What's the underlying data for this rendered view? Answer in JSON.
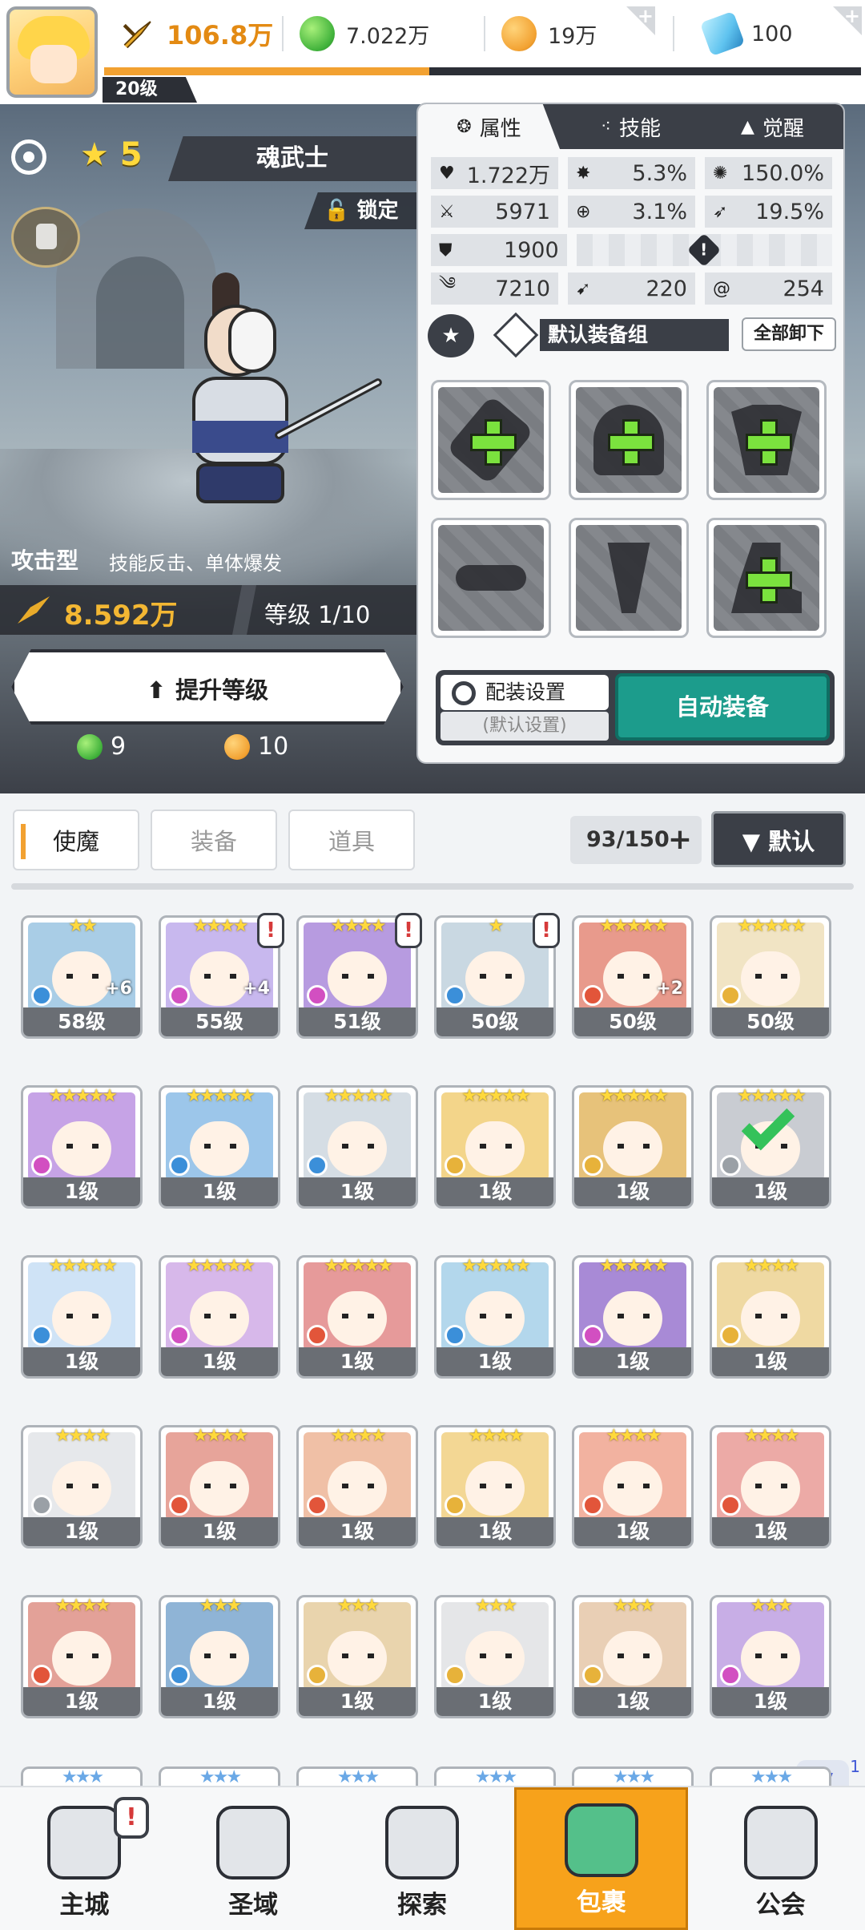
{
  "header": {
    "player_level": "20级",
    "power": "106.8万",
    "green_currency": "7.022万",
    "gold_currency": "19万",
    "gem_currency": "100",
    "colors": {
      "accent": "#f2a131",
      "dark": "#2c2f36"
    }
  },
  "hero": {
    "stars": "5",
    "name": "魂武士",
    "lock_label": "锁定",
    "type": "攻击型",
    "description": "技能反击、单体爆发",
    "power": "8.592万",
    "level_text": "等级 1/10",
    "upgrade_label": "提升等级",
    "cost_green": "9",
    "cost_gold": "10"
  },
  "panel": {
    "tabs": [
      {
        "label": "属性",
        "icon": "attribute-icon"
      },
      {
        "label": "技能",
        "icon": "skill-icon"
      },
      {
        "label": "觉醒",
        "icon": "awaken-icon"
      }
    ],
    "stats": {
      "hp": "1.722万",
      "crit_rate": "5.3%",
      "crit_damage": "150.0%",
      "attack": "5971",
      "accuracy": "3.1%",
      "dodge": "19.5%",
      "defense": "1900",
      "speed": "7210",
      "stat_a": "220",
      "stat_b": "254"
    },
    "equip_group": "默认装备组",
    "unequip_all": "全部卸下",
    "loadout_settings": "配装设置",
    "loadout_default": "(默认设置)",
    "auto_equip": "自动装备"
  },
  "bag": {
    "tabs": [
      "使魔",
      "装备",
      "道具"
    ],
    "count": "93/150",
    "sort_label": "默认",
    "items": [
      {
        "stars": "★★",
        "level": "58级",
        "color": "#a9cde6",
        "elem": "#3b8fd9",
        "plus": "+6",
        "alert": false
      },
      {
        "stars": "★★★★",
        "level": "55级",
        "color": "#c8b8ee",
        "elem": "#d24fc1",
        "plus": "+4",
        "alert": true
      },
      {
        "stars": "★★★★",
        "level": "51级",
        "color": "#b79be0",
        "elem": "#d24fc1",
        "plus": "",
        "alert": true
      },
      {
        "stars": "★",
        "level": "50级",
        "color": "#c9d8e2",
        "elem": "#3b8fd9",
        "plus": "",
        "alert": true
      },
      {
        "stars": "★★★★★",
        "level": "50级",
        "color": "#e89a8c",
        "elem": "#e2553a",
        "plus": "+2",
        "alert": false
      },
      {
        "stars": "★★★★★",
        "level": "50级",
        "color": "#f1e4c4",
        "elem": "#e7b23a",
        "plus": "",
        "alert": false
      },
      {
        "stars": "★★★★★",
        "level": "1级",
        "color": "#c6a3e6",
        "elem": "#d24fc1",
        "plus": "",
        "alert": false
      },
      {
        "stars": "★★★★★",
        "level": "1级",
        "color": "#9cc6ea",
        "elem": "#3b8fd9",
        "plus": "",
        "alert": false
      },
      {
        "stars": "★★★★★",
        "level": "1级",
        "color": "#d5dde4",
        "elem": "#3b8fd9",
        "plus": "",
        "alert": false
      },
      {
        "stars": "★★★★★",
        "level": "1级",
        "color": "#f3d58a",
        "elem": "#e7b23a",
        "plus": "",
        "alert": false
      },
      {
        "stars": "★★★★★",
        "level": "1级",
        "color": "#e7c27a",
        "elem": "#e7b23a",
        "plus": "",
        "alert": false
      },
      {
        "stars": "★★★★★",
        "level": "1级",
        "color": "#c9ccd2",
        "elem": "#9aa0a6",
        "plus": "",
        "alert": false,
        "check": true
      },
      {
        "stars": "★★★★★",
        "level": "1级",
        "color": "#cfe3f6",
        "elem": "#3b8fd9",
        "plus": "",
        "alert": false
      },
      {
        "stars": "★★★★★",
        "level": "1级",
        "color": "#d7b8ea",
        "elem": "#d24fc1",
        "plus": "",
        "alert": false
      },
      {
        "stars": "★★★★★",
        "level": "1级",
        "color": "#e69a9a",
        "elem": "#e2553a",
        "plus": "",
        "alert": false
      },
      {
        "stars": "★★★★★",
        "level": "1级",
        "color": "#b3d7ec",
        "elem": "#3b8fd9",
        "plus": "",
        "alert": false
      },
      {
        "stars": "★★★★★",
        "level": "1级",
        "color": "#a88ad6",
        "elem": "#d24fc1",
        "plus": "",
        "alert": false
      },
      {
        "stars": "★★★★",
        "level": "1级",
        "color": "#efd9a2",
        "elem": "#e7b23a",
        "plus": "",
        "alert": false
      },
      {
        "stars": "★★★★",
        "level": "1级",
        "color": "#e6e8eb",
        "elem": "#9aa0a6",
        "plus": "",
        "alert": false
      },
      {
        "stars": "★★★★",
        "level": "1级",
        "color": "#e7a49a",
        "elem": "#e2553a",
        "plus": "",
        "alert": false
      },
      {
        "stars": "★★★★",
        "level": "1级",
        "color": "#f0c0a6",
        "elem": "#e2553a",
        "plus": "",
        "alert": false
      },
      {
        "stars": "★★★★",
        "level": "1级",
        "color": "#f3d794",
        "elem": "#e7b23a",
        "plus": "",
        "alert": false
      },
      {
        "stars": "★★★★",
        "level": "1级",
        "color": "#f2b2a0",
        "elem": "#e2553a",
        "plus": "",
        "alert": false
      },
      {
        "stars": "★★★★",
        "level": "1级",
        "color": "#ecaaa6",
        "elem": "#e2553a",
        "plus": "",
        "alert": false
      },
      {
        "stars": "★★★★",
        "level": "1级",
        "color": "#e3a198",
        "elem": "#e2553a",
        "plus": "",
        "alert": false
      },
      {
        "stars": "★★★",
        "level": "1级",
        "color": "#8fb4d6",
        "elem": "#3b8fd9",
        "plus": "",
        "alert": false
      },
      {
        "stars": "★★★",
        "level": "1级",
        "color": "#e9d4ad",
        "elem": "#e7b23a",
        "plus": "",
        "alert": false
      },
      {
        "stars": "★★★",
        "level": "1级",
        "color": "#e5e6e8",
        "elem": "#e7b23a",
        "plus": "",
        "alert": false
      },
      {
        "stars": "★★★",
        "level": "1级",
        "color": "#e9cfb5",
        "elem": "#e7b23a",
        "plus": "",
        "alert": false
      },
      {
        "stars": "★★★",
        "level": "1级",
        "color": "#c8aee6",
        "elem": "#d24fc1",
        "plus": "",
        "alert": false
      }
    ],
    "partial_row": [
      "★★★",
      "★★★",
      "★★★",
      "★★★",
      "★★★",
      "★★★"
    ]
  },
  "nav": [
    {
      "label": "主城",
      "alert": true,
      "active": false
    },
    {
      "label": "圣域",
      "alert": false,
      "active": false
    },
    {
      "label": "探索",
      "alert": false,
      "active": false
    },
    {
      "label": "包裹",
      "alert": false,
      "active": true
    },
    {
      "label": "公会",
      "alert": false,
      "active": false
    }
  ],
  "side_badge": {
    "letter": "V",
    "count": "1"
  }
}
